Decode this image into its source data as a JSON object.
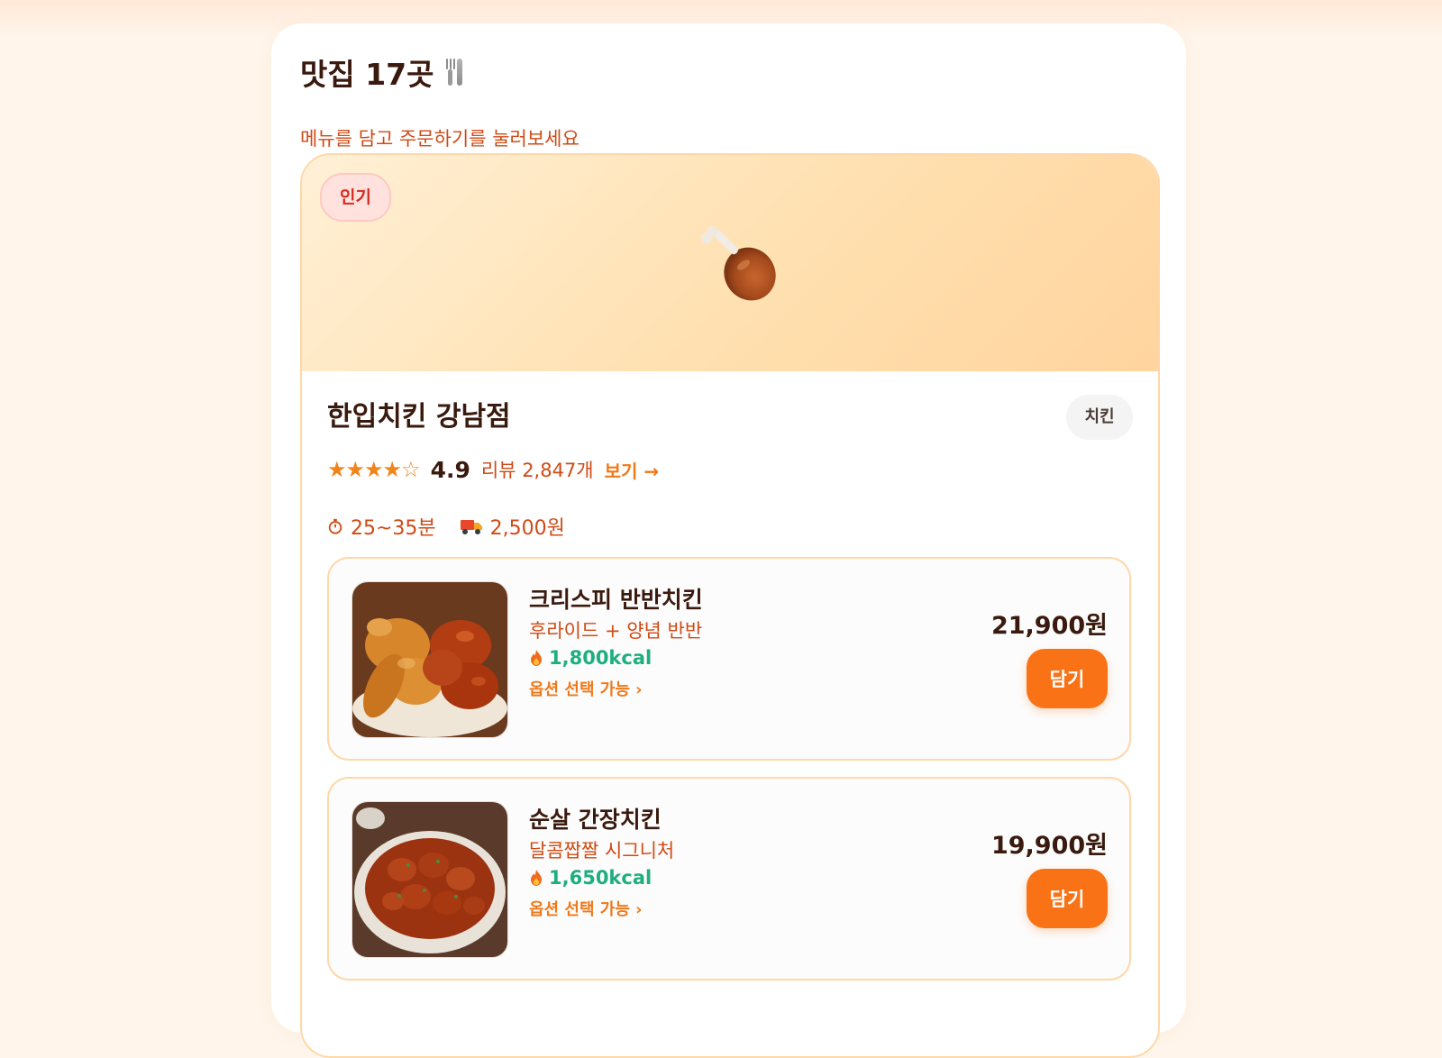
{
  "header": {
    "title": "맛집 17곳",
    "subtitle": "메뉴를 담고 주문하기를 눌러보세요"
  },
  "store": {
    "badge": "인기",
    "name": "한입치킨 강남점",
    "category": "치킨",
    "stars": "★★★★☆",
    "rating_stars": 4,
    "rating": "4.9",
    "review_count": "리뷰 2,847개",
    "review_link": "보기 →",
    "delivery_time": "25~35분",
    "delivery_fee": "2,500원",
    "hero_icon": "drumstick-icon"
  },
  "menu": [
    {
      "name": "크리스피 반반치킨",
      "description": "후라이드 + 양념 반반",
      "kcal": "1,800kcal",
      "option": "옵션 선택 가능 ›",
      "price": "21,900원",
      "add_label": "담기"
    },
    {
      "name": "순살 간장치킨",
      "description": "달콤짭짤 시그니처",
      "kcal": "1,650kcal",
      "option": "옵션 선택 가능 ›",
      "price": "19,900원",
      "add_label": "담기"
    }
  ],
  "colors": {
    "accent": "#f97316",
    "text_dark": "#3a1a0e",
    "text_orange": "#cf4a14",
    "kcal_green": "#1fae80",
    "card_border": "#ffd7a8"
  }
}
